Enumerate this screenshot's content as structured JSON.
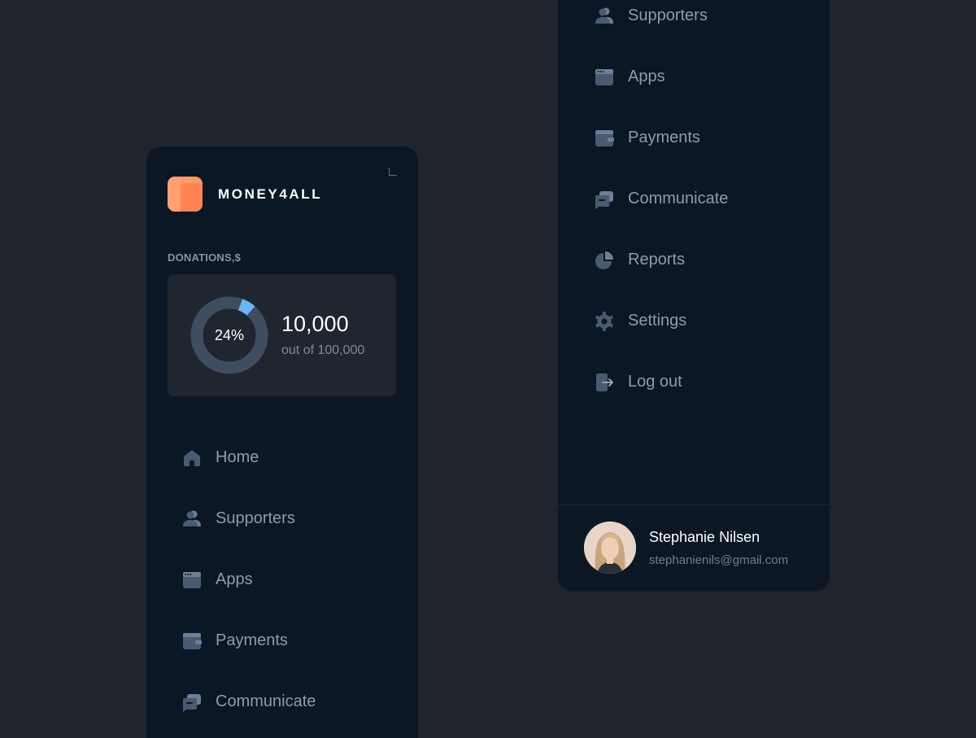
{
  "brand": {
    "name": "MONEY4ALL"
  },
  "donations": {
    "label": "DONATIONS,$",
    "percent_label": "24%",
    "percent": 24,
    "amount": "10,000",
    "out_of": "out of 100,000"
  },
  "left_nav": [
    {
      "label": "Home",
      "icon": "home-icon"
    },
    {
      "label": "Supporters",
      "icon": "users-icon"
    },
    {
      "label": "Apps",
      "icon": "apps-icon"
    },
    {
      "label": "Payments",
      "icon": "wallet-icon"
    },
    {
      "label": "Communicate",
      "icon": "chat-icon"
    }
  ],
  "right_nav": [
    {
      "label": "Supporters",
      "icon": "users-icon"
    },
    {
      "label": "Apps",
      "icon": "apps-icon"
    },
    {
      "label": "Payments",
      "icon": "wallet-icon"
    },
    {
      "label": "Communicate",
      "icon": "chat-icon"
    },
    {
      "label": "Reports",
      "icon": "pie-chart-icon"
    },
    {
      "label": "Settings",
      "icon": "gear-icon"
    },
    {
      "label": "Log out",
      "icon": "logout-icon"
    }
  ],
  "user": {
    "name": "Stephanie Nilsen",
    "email": "stephanienils@gmail.com"
  },
  "colors": {
    "background": "#1f242d",
    "panel": "#0b1724",
    "accent": "#6cb4f5",
    "donut_track": "#3f4d61",
    "logo": "#ff8a57"
  }
}
